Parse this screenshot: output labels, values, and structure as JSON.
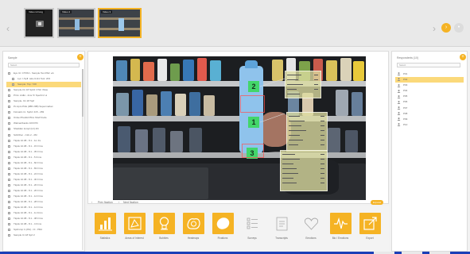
{
  "header": {
    "thumbnails": [
      {
        "label": "Video Ht long"
      },
      {
        "label": "Video 2"
      },
      {
        "label": "Video 3"
      }
    ],
    "selected_thumbnail": 2,
    "accent_color": "#f5b324"
  },
  "left_panel": {
    "title": "Sample",
    "filter_placeholder": "Select",
    "items": [
      "Eye Ut: CTRKJ - Sample Tes RSd: eA",
      "Lys: I-Spfl: wks-Unit1 Test: 203",
      "Sample: Tkp: Y08",
      "Sample-Oc.18 Sprld: 07Hr rhlwe",
      "Prtrs: Ardkt - 4ms Tc Sperbl 2 ui",
      "Sample- Oc.18 Sprl",
      "Pc Aprs Plds (38R 29B) Supermarket",
      "Fstmark rnt. Sprld: 215 - 283",
      "Ovlse Pharktd Pltcs Shelf fnwle",
      "Walmartbacks 10/0 Pth",
      "Shaddan ksmpl (tnI) 4th",
      "ScDrRoc - Ctrk 2 - 2M",
      "Tkpsk 10.08 - 8.1 - 1m frs",
      "Tkpsk 10.08 - 8.1 - 15 Frms",
      "Tkpsk 10.08 - 8.1 - 35 Frms",
      "Tkpsk 10.08 - 8.1 - 5 Frms",
      "Tkpsk 10.08 - 8.1 - 60 Frms",
      "Tkpsk 10.08 - 8.1 - 83 Frms",
      "Tkpsk 10.08 - 8.1 - 24 Frms",
      "Tkpsk 10.08 - 8.1 - 30 Frms",
      "Tkpsk 10.08 - 8.1 - 26 Frms",
      "Tkpsk 10.08 - 8.1 - 26 Frms",
      "Tkpsk 10.08 - 8.1 - 14 Frms",
      "Tkpsk 10.08 - 8.1 - 28 Frms",
      "Tkpsk 10.08 - 8.1 - 14 Frms",
      "Tkpsk 10.08 - 8.1 - 11 Frms",
      "Tkpsk 10.08 - 8.1 - 38 Frms",
      "Tkpsk 10.08 - 8.1 - 4 Frms",
      "Spdrsmp 1 (2St) - Cl - PRd",
      "Sample Cr.18 Sprl 2"
    ],
    "selected_index": 2,
    "child_indices": [
      1,
      2
    ]
  },
  "video": {
    "markers": [
      "2",
      "1",
      "3"
    ],
    "prev_label": "Prev fixation",
    "next_label": "Next fixation",
    "expand_label": "Expand"
  },
  "right_panel": {
    "title": "Respondents (10)",
    "filter_placeholder": "Select",
    "items": [
      "P01",
      "P02",
      "P03",
      "P04",
      "P05",
      "P06",
      "P07",
      "P08",
      "P09",
      "P10"
    ],
    "selected_index": 1
  },
  "toolbar": {
    "tools": [
      {
        "label": "Statistics",
        "icon": "bar-chart-icon",
        "active": true
      },
      {
        "label": "Areas of Interest",
        "icon": "aoi-icon",
        "active": true
      },
      {
        "label": "Bubbles",
        "icon": "bubble-icon",
        "active": true
      },
      {
        "label": "Heatmaps",
        "icon": "heatmap-icon",
        "active": true
      },
      {
        "label": "Fixations",
        "icon": "fixation-icon",
        "active": true
      },
      {
        "label": "Surveys",
        "icon": "list-icon",
        "active": false
      },
      {
        "label": "Transcripts",
        "icon": "text-icon",
        "active": false
      },
      {
        "label": "Emotions",
        "icon": "heart-icon",
        "active": false
      },
      {
        "label": "Bio / Emotions",
        "icon": "wave-icon",
        "active": true
      },
      {
        "label": "Export",
        "icon": "export-icon",
        "active": true
      }
    ]
  }
}
